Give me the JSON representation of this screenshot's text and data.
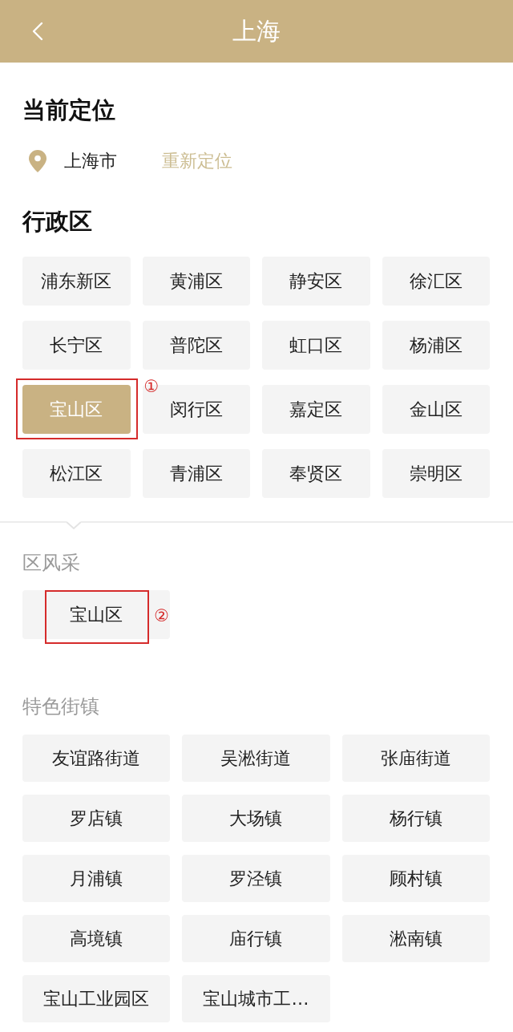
{
  "header": {
    "title": "上海"
  },
  "current_location": {
    "heading": "当前定位",
    "city": "上海市",
    "relocate": "重新定位"
  },
  "districts": {
    "heading": "行政区",
    "items": [
      {
        "label": "浦东新区",
        "selected": false
      },
      {
        "label": "黄浦区",
        "selected": false
      },
      {
        "label": "静安区",
        "selected": false
      },
      {
        "label": "徐汇区",
        "selected": false
      },
      {
        "label": "长宁区",
        "selected": false
      },
      {
        "label": "普陀区",
        "selected": false
      },
      {
        "label": "虹口区",
        "selected": false
      },
      {
        "label": "杨浦区",
        "selected": false
      },
      {
        "label": "宝山区",
        "selected": true,
        "annotation": "①"
      },
      {
        "label": "闵行区",
        "selected": false
      },
      {
        "label": "嘉定区",
        "selected": false
      },
      {
        "label": "金山区",
        "selected": false
      },
      {
        "label": "松江区",
        "selected": false
      },
      {
        "label": "青浦区",
        "selected": false
      },
      {
        "label": "奉贤区",
        "selected": false
      },
      {
        "label": "崇明区",
        "selected": false
      }
    ]
  },
  "district_features": {
    "heading": "区风采",
    "items": [
      {
        "label": "宝山区",
        "annotation": "②"
      }
    ]
  },
  "towns": {
    "heading": "特色街镇",
    "items": [
      {
        "label": "友谊路街道"
      },
      {
        "label": "吴淞街道"
      },
      {
        "label": "张庙街道"
      },
      {
        "label": "罗店镇"
      },
      {
        "label": "大场镇"
      },
      {
        "label": "杨行镇"
      },
      {
        "label": "月浦镇"
      },
      {
        "label": "罗泾镇"
      },
      {
        "label": "顾村镇"
      },
      {
        "label": "高境镇"
      },
      {
        "label": "庙行镇"
      },
      {
        "label": "淞南镇"
      },
      {
        "label": "宝山工业园区"
      },
      {
        "label": "宝山城市工…"
      }
    ]
  }
}
